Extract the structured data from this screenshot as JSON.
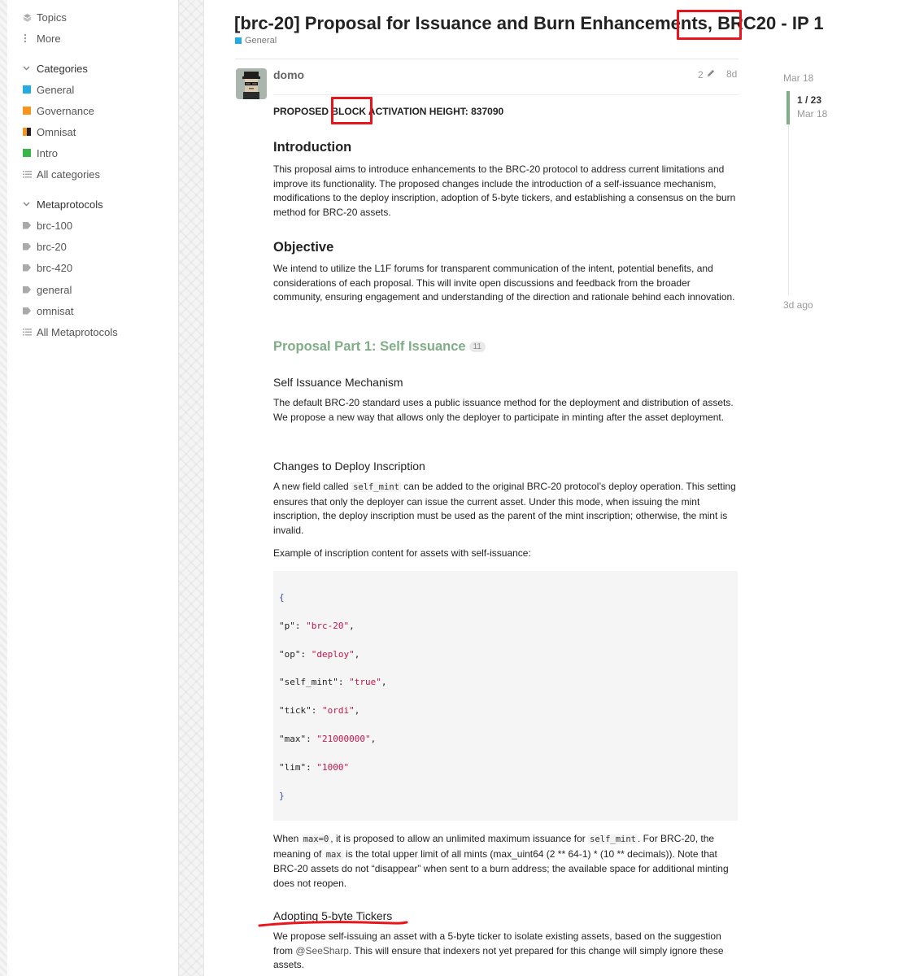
{
  "sidebar": {
    "top_items": [
      {
        "label": "Topics",
        "icon": "layers-icon"
      },
      {
        "label": "More",
        "icon": "vertical-ellipsis-icon"
      }
    ],
    "categories_header": "Categories",
    "categories": [
      {
        "label": "General",
        "color": "#25aae2"
      },
      {
        "label": "Governance",
        "color": "#f7941d"
      },
      {
        "label": "Omnisat",
        "color": "#231f20"
      },
      {
        "label": "Intro",
        "color": "#3ab54a"
      },
      {
        "label": "All categories"
      }
    ],
    "metaprotocols_header": "Metaprotocols",
    "metaprotocols": [
      {
        "label": "brc-100"
      },
      {
        "label": "brc-20"
      },
      {
        "label": "brc-420"
      },
      {
        "label": "general"
      },
      {
        "label": "omnisat"
      },
      {
        "label": "All Metaprotocols"
      }
    ]
  },
  "topic": {
    "title_prefix": "[brc-20] Proposal for Issuance and Burn Enhancements, ",
    "title_highlight": "BRC20",
    "title_suffix": " - IP 1",
    "category": "General",
    "category_color": "#25aae2"
  },
  "post": {
    "author": "domo",
    "edit_count": "2",
    "age": "8d",
    "block_prefix": "PROPOSED ",
    "block_highlight": "BLOCK",
    "block_suffix": " ACTIVATION HEIGHT: 837090",
    "intro_heading": "Introduction",
    "intro_text": "This proposal aims to introduce enhancements to the BRC-20 protocol to address current limitations and improve its functionality. The proposed changes include the introduction of a self-issuance mechanism, modifications to the deploy inscription, adoption of 5-byte tickers, and establishing a consensus on the burn method for BRC-20 assets.",
    "objective_heading": "Objective",
    "objective_text": "We intend to utilize the L1F forums for transparent communication of the intent, potential benefits, and considerations of each proposal. This will invite open discussions and feedback from the broader community, ensuring engagement and understanding of the direction and rationale behind each innovation.",
    "part1_heading": "Proposal Part 1: Self Issuance",
    "part1_count": "11",
    "self_issuance_heading": "Self Issuance Mechanism",
    "self_issuance_text": "The default BRC-20 standard uses a public issuance method for the deployment and distribution of assets. We propose a new way that allows only the deployer to participate in minting after the asset deployment.",
    "deploy_heading": "Changes to Deploy Inscription",
    "deploy_text_1": "A new field called ",
    "deploy_code": "self_mint",
    "deploy_text_2": " can be added to the original BRC-20 protocol’s deploy operation. This setting ensures that only the deployer can issue the current asset. Under this mode, when issuing the mint inscription, the deploy inscription must be used as the parent of the mint inscription; otherwise, the mint is invalid.",
    "example_label": "Example of inscription content for assets with self-issuance:",
    "code_lines": [
      {
        "key": "",
        "value": "{"
      },
      {
        "key": "\"p\": ",
        "value": "\"brc-20\"",
        "tail": ","
      },
      {
        "key": "\"op\": ",
        "value": "\"deploy\"",
        "tail": ","
      },
      {
        "key": "\"self_mint\": ",
        "value": "\"true\"",
        "tail": ","
      },
      {
        "key": "\"tick\": ",
        "value": "\"ordi\"",
        "tail": ","
      },
      {
        "key": "\"max\": ",
        "value": "\"21000000\"",
        "tail": ","
      },
      {
        "key": "\"lim\": ",
        "value": "\"1000\"",
        "tail": ""
      },
      {
        "key": "",
        "value": "}"
      }
    ],
    "max_text_1": "When ",
    "max_code_1": "max=0",
    "max_text_2": ", it is proposed to allow an unlimited maximum issuance for ",
    "max_code_2": "self_mint",
    "max_text_3": ". For BRC-20, the meaning of ",
    "max_code_3": "max",
    "max_text_4": " is the total upper limit of all mints (max_uint64 (2 ** 64-1) * (10 ** decimals)). Note that BRC-20 assets do not “disappear” when sent to a burn address; the available space for additional minting does not reopen.",
    "tickers_heading": "Adopting 5-byte Tickers",
    "tickers_text_1": "We propose self-issuing an asset with a 5-byte ticker to isolate existing assets, based on the suggestion from ",
    "tickers_mention": "@SeeSharp",
    "tickers_text_2": ". This will ensure that indexers not yet prepared for this change will simply ignore these assets."
  },
  "timeline": {
    "start_date": "Mar 18",
    "position": "1 / 23",
    "position_fraction": 0.043,
    "current_date": "Mar 18",
    "end_label": "3d ago"
  },
  "colors": {
    "accent_green": "#7fad85",
    "annotation_red": "#e8161c",
    "code_string": "#c4164a"
  }
}
